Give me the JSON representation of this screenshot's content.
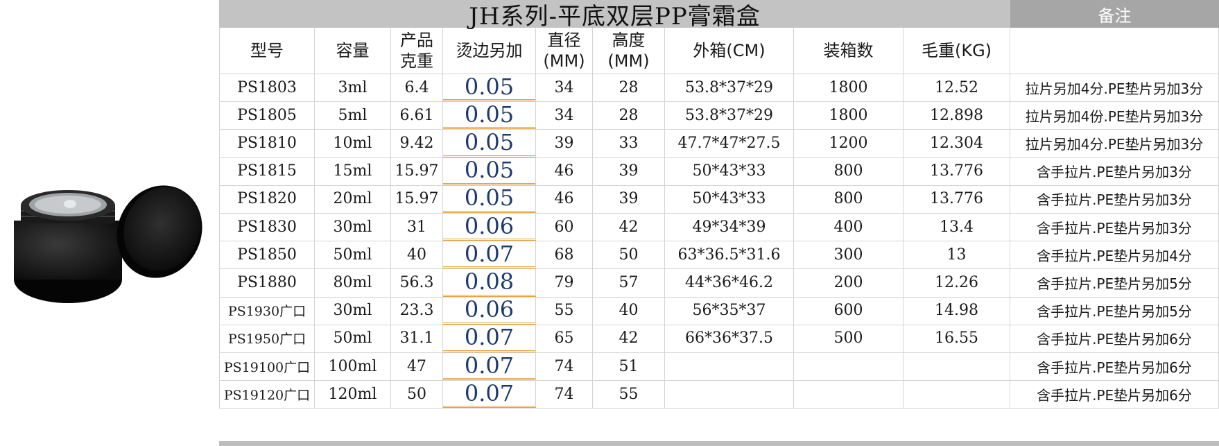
{
  "title": "JH系列-平底双层PP膏霜盒",
  "note_header": "备注",
  "headers": {
    "model": "型号",
    "capacity": "容量",
    "weight": "产品\n克重",
    "hot_edge": "烫边另加",
    "diameter": "直径\n(MM)",
    "height": "高度\n(MM)",
    "carton": "外箱(CM)",
    "qty": "装箱数",
    "gross": "毛重(KG)",
    "note": ""
  },
  "rows": [
    {
      "model": "PS1803",
      "capacity": "3ml",
      "weight": "6.4",
      "hot_edge": "0.05",
      "diameter": "34",
      "height": "28",
      "carton": "53.8*37*29",
      "qty": "1800",
      "gross": "12.52",
      "note": "拉片另加4分.PE垫片另加3分"
    },
    {
      "model": "PS1805",
      "capacity": "5ml",
      "weight": "6.61",
      "hot_edge": "0.05",
      "diameter": "34",
      "height": "28",
      "carton": "53.8*37*29",
      "qty": "1800",
      "gross": "12.898",
      "note": "拉片另加4份.PE垫片另加3分"
    },
    {
      "model": "PS1810",
      "capacity": "10ml",
      "weight": "9.42",
      "hot_edge": "0.05",
      "diameter": "39",
      "height": "33",
      "carton": "47.7*47*27.5",
      "qty": "1200",
      "gross": "12.304",
      "note": "拉片另加4分.PE垫片另加3分"
    },
    {
      "model": "PS1815",
      "capacity": "15ml",
      "weight": "15.97",
      "hot_edge": "0.05",
      "diameter": "46",
      "height": "39",
      "carton": "50*43*33",
      "qty": "800",
      "gross": "13.776",
      "note": "含手拉片.PE垫片另加3分"
    },
    {
      "model": "PS1820",
      "capacity": "20ml",
      "weight": "15.97",
      "hot_edge": "0.05",
      "diameter": "46",
      "height": "39",
      "carton": "50*43*33",
      "qty": "800",
      "gross": "13.776",
      "note": "含手拉片.PE垫片另加3分"
    },
    {
      "model": "PS1830",
      "capacity": "30ml",
      "weight": "31",
      "hot_edge": "0.06",
      "diameter": "60",
      "height": "42",
      "carton": "49*34*39",
      "qty": "400",
      "gross": "13.4",
      "note": "含手拉片.PE垫片另加3分"
    },
    {
      "model": "PS1850",
      "capacity": "50ml",
      "weight": "40",
      "hot_edge": "0.07",
      "diameter": "68",
      "height": "50",
      "carton": "63*36.5*31.6",
      "qty": "300",
      "gross": "13",
      "note": "含手拉片.PE垫片另加4分"
    },
    {
      "model": "PS1880",
      "capacity": "80ml",
      "weight": "56.3",
      "hot_edge": "0.08",
      "diameter": "79",
      "height": "57",
      "carton": "44*36*46.2",
      "qty": "200",
      "gross": "12.26",
      "note": "含手拉片.PE垫片另加5分"
    },
    {
      "model": "PS1930广口",
      "capacity": "30ml",
      "weight": "23.3",
      "hot_edge": "0.06",
      "diameter": "55",
      "height": "40",
      "carton": "56*35*37",
      "qty": "600",
      "gross": "14.98",
      "note": "含手拉片.PE垫片另加5分"
    },
    {
      "model": "PS1950广口",
      "capacity": "50ml",
      "weight": "31.1",
      "hot_edge": "0.07",
      "diameter": "65",
      "height": "42",
      "carton": "66*36*37.5",
      "qty": "500",
      "gross": "16.55",
      "note": "含手拉片.PE垫片另加6分"
    },
    {
      "model": "PS19100广口",
      "capacity": "100ml",
      "weight": "47",
      "hot_edge": "0.07",
      "diameter": "74",
      "height": "51",
      "carton": "",
      "qty": "",
      "gross": "",
      "note": "含手拉片.PE垫片另加6分"
    },
    {
      "model": "PS19120广口",
      "capacity": "120ml",
      "weight": "50",
      "hot_edge": "0.07",
      "diameter": "74",
      "height": "55",
      "carton": "",
      "qty": "",
      "gross": "",
      "note": "含手拉片.PE垫片另加6分"
    }
  ],
  "colors": {
    "title_bg": "#c3c3c3",
    "note_header_bg": "#a6a6a6",
    "hot_edge_text": "#1d3b6e",
    "hot_edge_underline": "#e8a23a"
  }
}
